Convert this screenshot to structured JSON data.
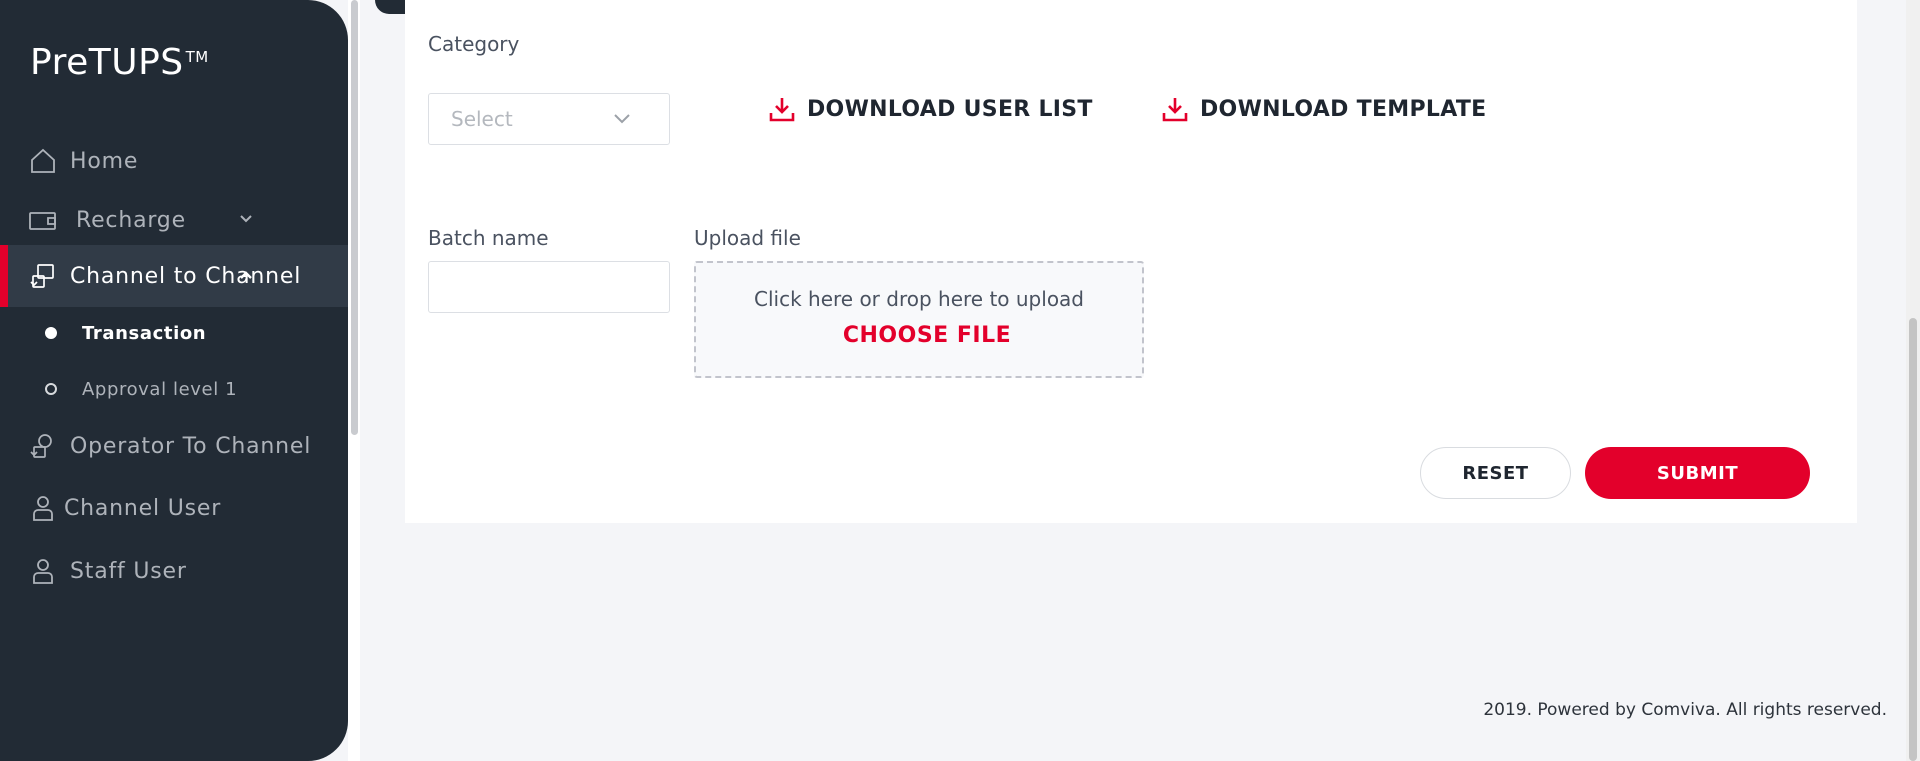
{
  "app": {
    "logo": "PreTUPS",
    "logo_tm": "TM"
  },
  "sidebar": {
    "items": [
      {
        "label": "Home",
        "icon": "home-icon"
      },
      {
        "label": "Recharge",
        "icon": "wallet-icon"
      },
      {
        "label": "Channel to Channel",
        "icon": "channel-transfer-icon",
        "active": true
      },
      {
        "label": "Operator To Channel",
        "icon": "operator-icon"
      },
      {
        "label": "Channel User",
        "icon": "user-icon"
      },
      {
        "label": "Staff User",
        "icon": "user-icon"
      }
    ],
    "sub_items": [
      {
        "label": "Transaction",
        "current": true
      },
      {
        "label": "Approval level 1",
        "current": false
      }
    ]
  },
  "form": {
    "category_label": "Category",
    "category_placeholder": "Select",
    "download_user_list": "DOWNLOAD USER LIST",
    "download_template": "DOWNLOAD TEMPLATE",
    "batch_name_label": "Batch name",
    "batch_name_value": "",
    "upload_label": "Upload file",
    "upload_hint": "Click here or drop here to upload",
    "choose_file": "CHOOSE FILE",
    "reset_label": "RESET",
    "submit_label": "SUBMIT"
  },
  "footer": {
    "text": "2019. Powered by Comviva. All rights reserved."
  },
  "colors": {
    "accent": "#e3002b",
    "sidebar": "#222b35",
    "sidebar_active": "#313b47"
  }
}
